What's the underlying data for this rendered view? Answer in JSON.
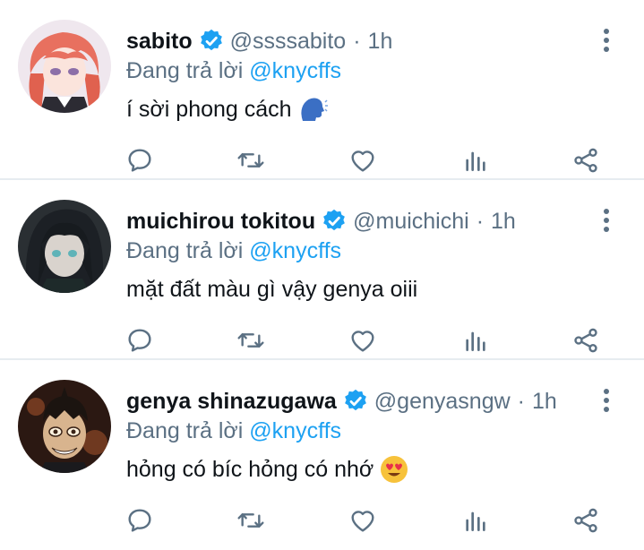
{
  "colors": {
    "text": "#0f1419",
    "muted": "#5b7083",
    "accent": "#1da1f2",
    "divider": "#e6ecf0"
  },
  "tweets": [
    {
      "name": "sabito",
      "handle": "@ssssabito",
      "separator": "·",
      "time": "1h",
      "reply_prefix": "Đang trả lời",
      "reply_to": "@knycffs",
      "text": "í sời phong cách",
      "emoji": "speaking-head-icon",
      "avatar": "avatar-sabito"
    },
    {
      "name": "muichirou tokitou",
      "handle": "@muichichi",
      "separator": "·",
      "time": "1h",
      "reply_prefix": "Đang trả lời",
      "reply_to": "@knycffs",
      "text": "mặt đất màu gì vậy genya oiii",
      "emoji": "",
      "avatar": "avatar-muichirou"
    },
    {
      "name": "genya shinazugawa",
      "handle": "@genyasngw",
      "separator": "·",
      "time": "1h",
      "reply_prefix": "Đang trả lời",
      "reply_to": "@knycffs",
      "text": "hỏng có bíc hỏng có nhớ",
      "emoji": "heart-eyes-icon",
      "avatar": "avatar-genya"
    }
  ],
  "actions": [
    "reply-icon",
    "retweet-icon",
    "like-icon",
    "analytics-icon",
    "share-icon"
  ]
}
